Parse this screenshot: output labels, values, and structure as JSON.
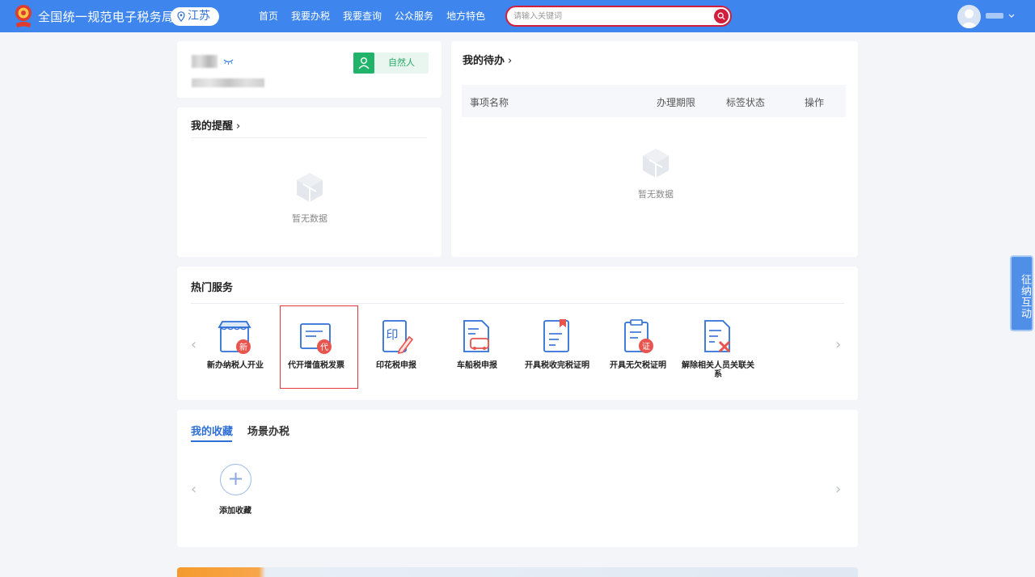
{
  "header": {
    "site_title": "全国统一规范电子税务局",
    "region": "江苏",
    "nav": [
      "首页",
      "我要办税",
      "我要查询",
      "公众服务",
      "地方特色"
    ],
    "search_placeholder": "请输入关键词",
    "accent_color": "#3e86ee",
    "search_border_color": "#d21e3c"
  },
  "profile": {
    "identity_badge": "自然人"
  },
  "reminders": {
    "title": "我的提醒",
    "empty_text": "暂无数据"
  },
  "todo": {
    "title": "我的待办",
    "columns": [
      "事项名称",
      "办理期限",
      "标签状态",
      "操作"
    ],
    "empty_text": "暂无数据"
  },
  "hot_services": {
    "title": "热门服务",
    "items": [
      {
        "label": "新办纳税人开业",
        "icon": "new-taxpayer-icon"
      },
      {
        "label": "代开增值税发票",
        "icon": "vat-invoice-icon",
        "selected": true
      },
      {
        "label": "印花税申报",
        "icon": "stamp-tax-icon"
      },
      {
        "label": "车船税申报",
        "icon": "vehicle-tax-icon"
      },
      {
        "label": "开具税收完税证明",
        "icon": "tax-payment-certificate-icon"
      },
      {
        "label": "开具无欠税证明",
        "icon": "no-tax-arrears-certificate-icon"
      },
      {
        "label": "解除相关人员关联关系",
        "icon": "remove-relation-icon"
      }
    ]
  },
  "favorites": {
    "tabs": [
      "我的收藏",
      "场景办税"
    ],
    "active_tab": "我的收藏",
    "add_label": "添加收藏"
  },
  "side_float": {
    "label": "征纳互动"
  }
}
